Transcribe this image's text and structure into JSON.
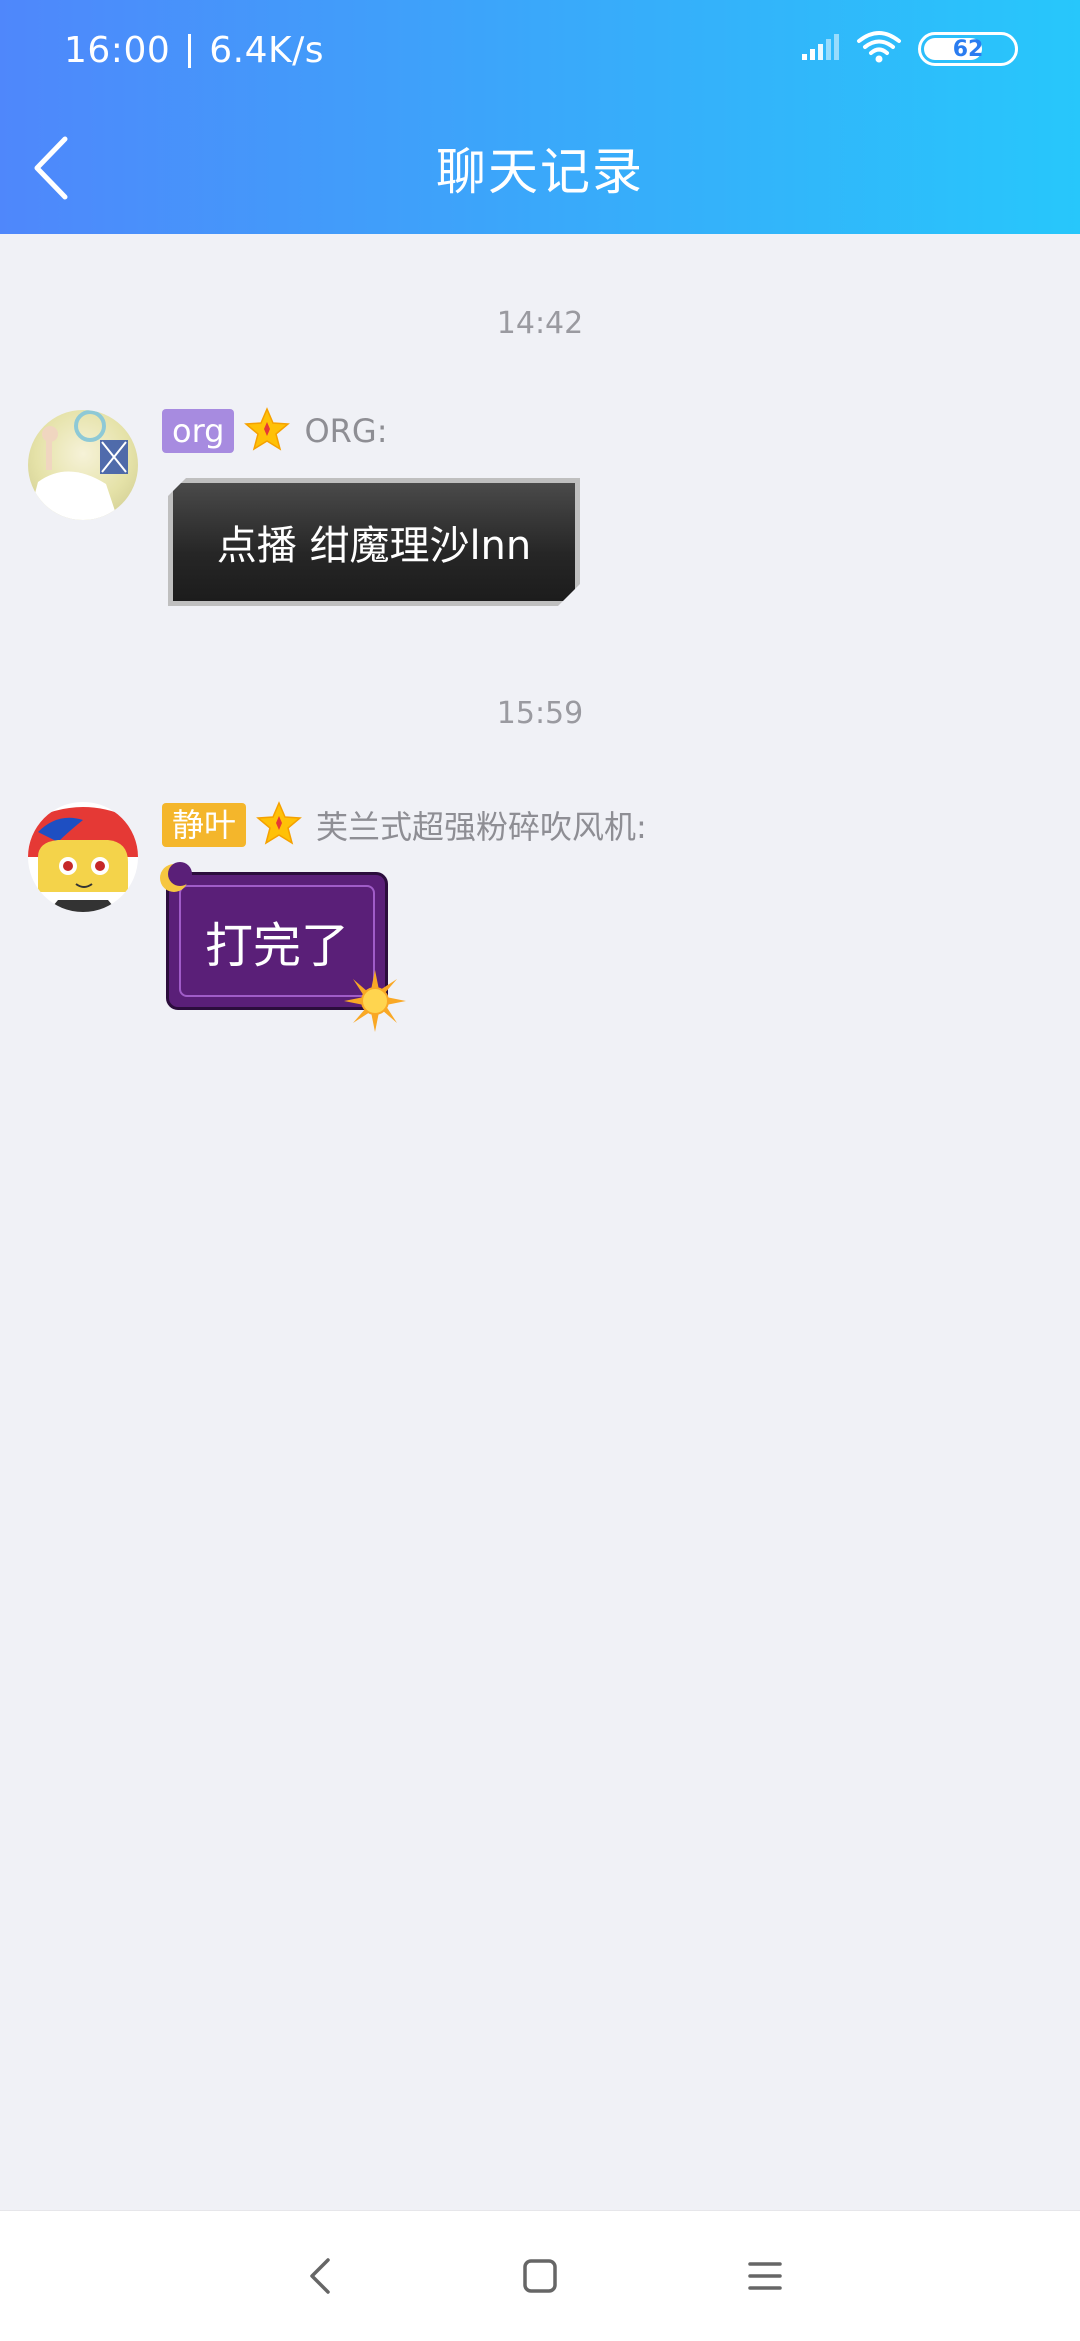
{
  "status_bar": {
    "time": "16:00",
    "speed": "6.4K/s",
    "battery": "62",
    "battery_level": 0.62
  },
  "header": {
    "title": "聊天记录"
  },
  "messages": [
    {
      "timestamp": "14:42",
      "tag": "org",
      "tag_color": "#a78be0",
      "sender": "ORG:",
      "text": "点播 绀魔理沙lnn"
    },
    {
      "timestamp": "15:59",
      "tag": "静叶",
      "tag_color": "#f4b62b",
      "sender": "芙兰式超强粉碎吹风机:",
      "text": "打完了"
    }
  ],
  "colors": {
    "header_start": "#4f87fb",
    "header_end": "#27c7fb",
    "background": "#f0f1f6",
    "star": "#ffc107"
  },
  "icons": {
    "back": "chevron-left-icon",
    "star": "star-icon",
    "signal": "signal-icon",
    "wifi": "wifi-icon",
    "battery": "battery-icon",
    "nav_back": "triangle-back-icon",
    "nav_home": "square-home-icon",
    "nav_menu": "menu-lines-icon"
  }
}
